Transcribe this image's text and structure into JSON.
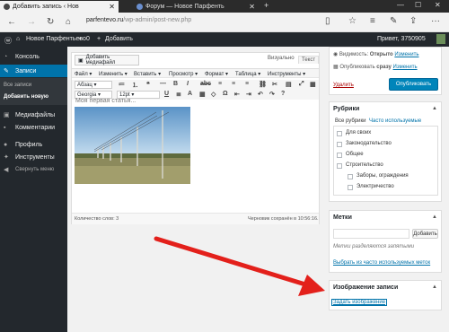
{
  "browser": {
    "active_tab_title": "Добавить запись ‹ Нов",
    "inactive_tab_title": "Форум — Новое Парфенть",
    "url_host": "parfentevo.ru",
    "url_path": "/wp-admin/post-new.php"
  },
  "adminbar": {
    "site_name": "Новое Парфентьево",
    "comments_count": "0",
    "new_label": "Добавить",
    "greeting": "Привет, 3750905"
  },
  "sidebar": {
    "items": [
      {
        "label": "Консоль"
      },
      {
        "label": "Записи"
      },
      {
        "label": "Медиафайлы"
      },
      {
        "label": "Комментарии"
      },
      {
        "label": "Профиль"
      },
      {
        "label": "Инструменты"
      },
      {
        "label": "Свернуть меню"
      }
    ],
    "sub": [
      "Все записи",
      "Добавить новую"
    ]
  },
  "editor": {
    "media_button": "Добавить медиафайл",
    "tab_visual": "Визуально",
    "tab_text": "Текст",
    "menu": [
      "Файл ▾",
      "Изменить ▾",
      "Вставить ▾",
      "Просмотр ▾",
      "Формат ▾",
      "Таблица ▾",
      "Инструменты ▾"
    ],
    "format_select": "Абзац",
    "font_select": "Georgia",
    "size_select": "12pt",
    "content_heading": "Моя первая статья...",
    "word_count": "Количество слов: 3",
    "draft_saved": "Черновик сохранён в 10:56:16."
  },
  "publish": {
    "visibility_label": "Видимость:",
    "visibility_value": "Открыто",
    "visibility_edit": "Изменить",
    "publish_label": "Опубликовать",
    "publish_value": "сразу",
    "publish_edit": "Изменить",
    "delete_link": "Удалить",
    "publish_button": "Опубликовать"
  },
  "categories": {
    "title": "Рубрики",
    "tab_all": "Все рубрики",
    "tab_popular": "Часто используемые",
    "items": [
      "Для своих",
      "Законодательство",
      "Общее",
      "Строительство",
      "Заборы, ограждения",
      "Электричество"
    ]
  },
  "tags": {
    "title": "Метки",
    "add_button": "Добавить",
    "hint": "Метки разделяются запятыми",
    "choose_link": "Выбрать из часто используемых меток"
  },
  "featured": {
    "title": "Изображение записи",
    "set_link": "Задать изображение"
  },
  "colors": {
    "wp_dark": "#23282d",
    "wp_blue": "#0073aa",
    "arrow_red": "#e3201b"
  }
}
